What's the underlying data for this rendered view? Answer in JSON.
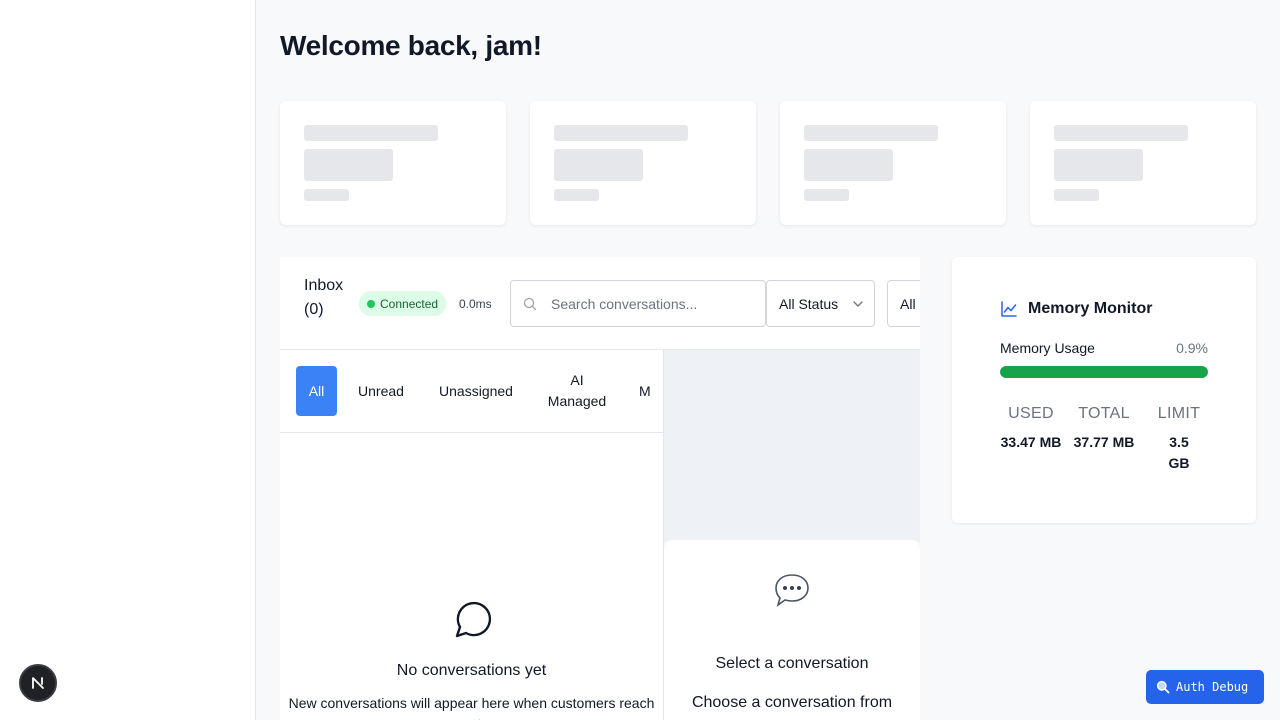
{
  "page": {
    "title": "Welcome back, jam!"
  },
  "stats": {
    "loading": true,
    "card_count": 4
  },
  "inbox": {
    "title": "Inbox (0)",
    "connection_status": "Connected",
    "latency": "0.0ms",
    "search_placeholder": "Search conversations...",
    "status_filter": "All Status",
    "second_filter": "All",
    "tabs": [
      {
        "label": "All",
        "active": true
      },
      {
        "label": "Unread",
        "active": false
      },
      {
        "label": "Unassigned",
        "active": false
      },
      {
        "label": "AI Managed",
        "active": false
      },
      {
        "label": "M",
        "active": false
      }
    ],
    "empty_title": "No conversations yet",
    "empty_description": "New conversations will appear here when customers reach out"
  },
  "detail": {
    "icon": "speech-bubble-icon",
    "title": "Select a conversation",
    "description": "Choose a conversation from"
  },
  "memory": {
    "title": "Memory Monitor",
    "usage_label": "Memory Usage",
    "usage_percent": "0.9%",
    "usage_fraction": 0.009,
    "bar_color": "#16a34a",
    "used_label": "USED",
    "used_value": "33.47 MB",
    "total_label": "TOTAL",
    "total_value": "37.77 MB",
    "limit_label": "LIMIT",
    "limit_value": "3.5 GB"
  },
  "debug": {
    "label": "Auth Debug",
    "icon": "magnifier-icon"
  },
  "colors": {
    "accent": "#3b82f6",
    "success": "#22c55e",
    "debug_button": "#2563eb"
  }
}
